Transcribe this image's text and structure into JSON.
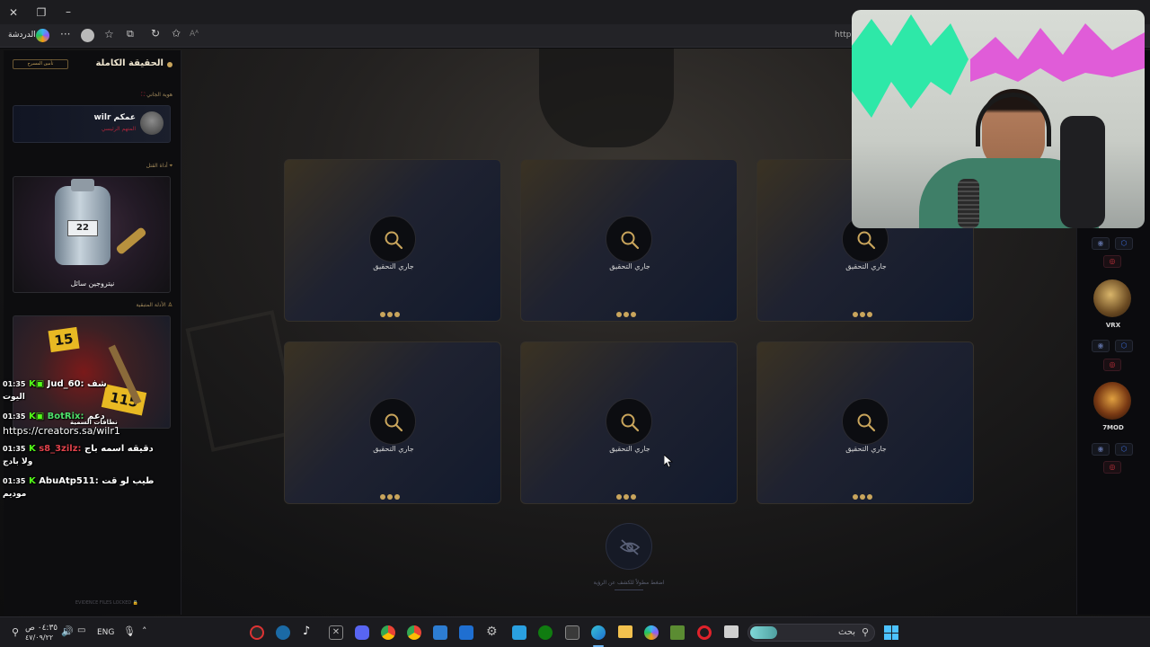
{
  "browser": {
    "tab_label": "الدردشة",
    "url_partial": "https:",
    "read_aloud_label": "Aᴬ"
  },
  "sidebar": {
    "title": "الحقيقة الكاملة",
    "badge_label": "تأمين المسرح",
    "suspect_section_label": "هوية الجاني",
    "suspect": {
      "name": "wilr عمكم",
      "role": "المتهم الرئيسي"
    },
    "weapon_section_label": "أداة القتل",
    "weapon": {
      "bottle_number": "22",
      "label": "نيتروجين سائل"
    },
    "evidence_section_label": "الأدلة المتبقية",
    "evidence_tags": [
      "15",
      "115"
    ],
    "footer_label": "EVIDENCE FILES LOCKED"
  },
  "cards": [
    {
      "label": "جاري التحقيق"
    },
    {
      "label": "جاري التحقيق"
    },
    {
      "label": "جاري التحقيق"
    },
    {
      "label": "جاري التحقيق"
    },
    {
      "label": "جاري التحقيق"
    },
    {
      "label": "جاري التحقيق"
    }
  ],
  "reveal": {
    "hint": "اضغط مطولاً للكشف عن الرؤية"
  },
  "right_rail": {
    "players": [
      {
        "name": "VRX"
      },
      {
        "name": "7MOD"
      }
    ]
  },
  "chat": [
    {
      "time": "01:35",
      "user": "Jud_60:",
      "message": "شف",
      "continuation": "اليوت",
      "user_color": "#ffffff"
    },
    {
      "time": "01:35",
      "user": "BotRix:",
      "message": "دعم",
      "continuation": "https://creators.sa/wilr1",
      "extra": "نطاقات السمية",
      "user_color": "#4ee06a"
    },
    {
      "time": "01:35",
      "user": "s8_3zilz:",
      "message": "دقيقه اسمه باج",
      "continuation": "ولا بادج",
      "user_color": "#e0424b"
    },
    {
      "time": "01:35",
      "user": "AbuAtp511:",
      "message": "طيب لو قت",
      "continuation": "موديم",
      "user_color": "#ffffff"
    }
  ],
  "taskbar": {
    "time": "٠٤:٣٥ ص",
    "date": "٤٧/٠٩/٢٢",
    "lang": "ENG",
    "search_placeholder": "بحث"
  },
  "colors": {
    "accent_gold": "#c9a55c",
    "danger_red": "#b0263b",
    "panel_bg": "#0d0d0f"
  }
}
